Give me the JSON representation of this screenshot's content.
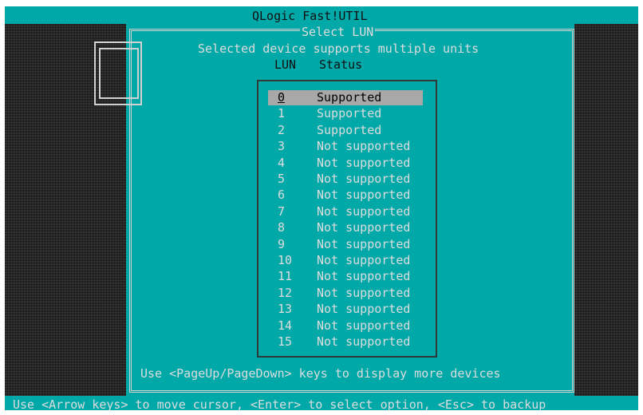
{
  "app": {
    "title": "QLogic Fast!UTIL"
  },
  "dialog": {
    "title": "Select LUN",
    "message": "Selected device supports multiple units",
    "col_lun": "LUN",
    "col_status": "Status",
    "hint": "Use <PageUp/PageDown> keys to display more devices"
  },
  "lun_list": [
    {
      "lun": "0",
      "status": "Supported",
      "selected": true
    },
    {
      "lun": "1",
      "status": "Supported"
    },
    {
      "lun": "2",
      "status": "Supported"
    },
    {
      "lun": "3",
      "status": "Not supported"
    },
    {
      "lun": "4",
      "status": "Not supported"
    },
    {
      "lun": "5",
      "status": "Not supported"
    },
    {
      "lun": "6",
      "status": "Not supported"
    },
    {
      "lun": "7",
      "status": "Not supported"
    },
    {
      "lun": "8",
      "status": "Not supported"
    },
    {
      "lun": "9",
      "status": "Not supported"
    },
    {
      "lun": "10",
      "status": "Not supported"
    },
    {
      "lun": "11",
      "status": "Not supported"
    },
    {
      "lun": "12",
      "status": "Not supported"
    },
    {
      "lun": "13",
      "status": "Not supported"
    },
    {
      "lun": "14",
      "status": "Not supported"
    },
    {
      "lun": "15",
      "status": "Not supported"
    }
  ],
  "status_bar": {
    "text": "Use <Arrow keys> to move cursor, <Enter> to select option, <Esc> to backup"
  },
  "colors": {
    "background": "#00a8a8",
    "text": "#dcdcdc",
    "highlight": "#a8a8a8",
    "dither": "#0a0a0a"
  }
}
